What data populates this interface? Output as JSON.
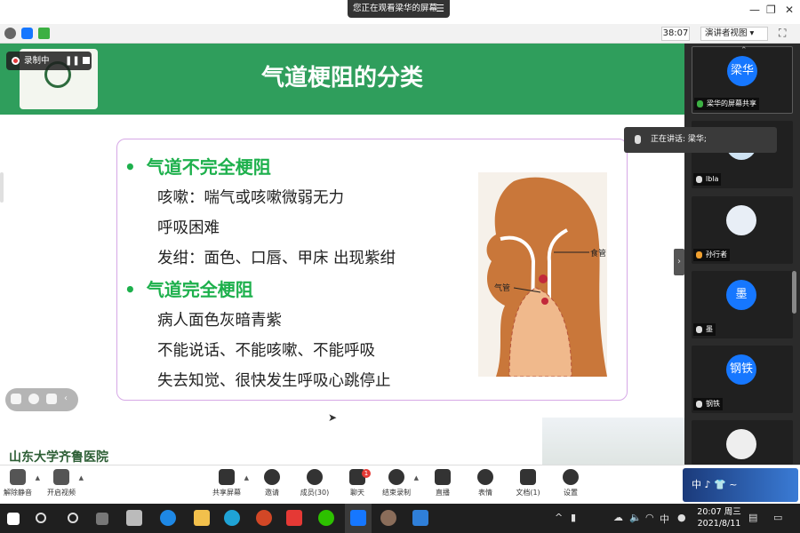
{
  "window": {
    "share_notice": "您正在观看梁华的屏幕",
    "timer": "38:07",
    "view_mode": "演讲者视图"
  },
  "recording": {
    "label": "录制中"
  },
  "slide": {
    "title": "气道梗阻的分类",
    "sections": [
      {
        "heading": "气道不完全梗阻",
        "lines": [
          "咳嗽：喘气或咳嗽微弱无力",
          "呼吸困难",
          "发绀：面色、口唇、甲床 出现紫绀"
        ]
      },
      {
        "heading": "气道完全梗阻",
        "lines": [
          "病人面色灰暗青紫",
          "不能说话、不能咳嗽、不能呼吸",
          "失去知觉、很快发生呼吸心跳停止"
        ]
      }
    ],
    "illustration_labels": {
      "esophagus": "食管",
      "trachea": "气管"
    },
    "footer_logo": "山东大学齐鲁医院"
  },
  "speaking": {
    "label": "正在讲话: 梁华;"
  },
  "participants": [
    {
      "avatar_text": "梁华",
      "name": "梁华的屏幕共享"
    },
    {
      "avatar_text": "",
      "name": "lbla"
    },
    {
      "avatar_text": "",
      "name": "孙行者"
    },
    {
      "avatar_text": "墨",
      "name": "墨"
    },
    {
      "avatar_text": "钢铁",
      "name": "钢铁"
    },
    {
      "avatar_text": "",
      "name": ""
    }
  ],
  "meeting_toolbar": {
    "unmute": "解除静音",
    "start_video": "开启视频",
    "share_screen": "共享屏幕",
    "invite": "邀请",
    "members": "成员(30)",
    "chat": "聊天",
    "chat_badge": "1",
    "end_recording": "结束录制",
    "live": "直播",
    "reactions": "表情",
    "docs": "文档(1)",
    "settings": "设置"
  },
  "taskbar": {
    "ime": "中",
    "time": "20:07 周三",
    "date": "2021/8/11"
  },
  "colors": {
    "slide_header": "#2f9e5c",
    "heading_green": "#1db04c",
    "avatar_blue": "#1677ff"
  }
}
